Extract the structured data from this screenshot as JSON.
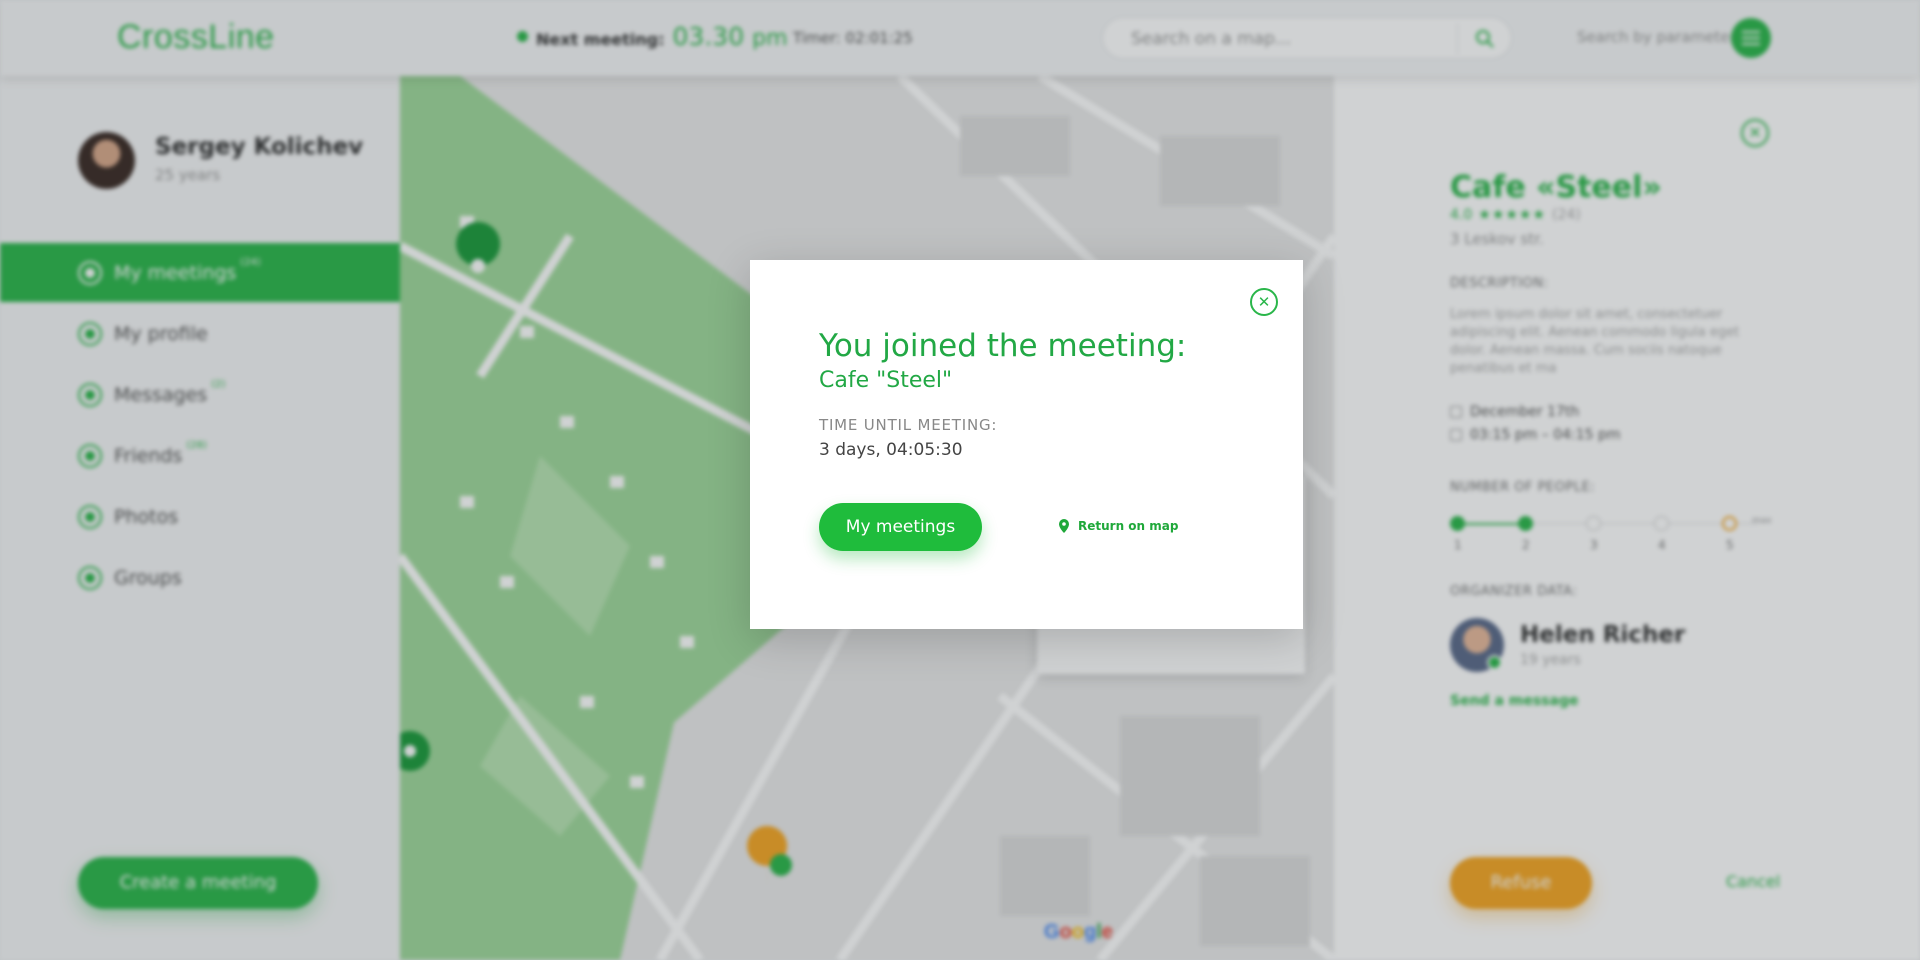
{
  "header": {
    "logo": "CrossLine",
    "next_meeting_label": "Next meeting:",
    "next_meeting_time": "03.30",
    "next_meeting_ampm": "pm",
    "timer": "Timer: 02:01:25",
    "search_placeholder": "Search on a map...",
    "search_params": "Search by parameters"
  },
  "user": {
    "name": "Sergey Kolichev",
    "age": "25 years"
  },
  "nav": [
    {
      "label": "My meetings",
      "count": "(24)",
      "active": true
    },
    {
      "label": "My profile",
      "count": ""
    },
    {
      "label": "Messages",
      "count": "(2)"
    },
    {
      "label": "Friends",
      "count": "(28)"
    },
    {
      "label": "Photos",
      "count": ""
    },
    {
      "label": "Groups",
      "count": ""
    }
  ],
  "create_button": "Create a meeting",
  "map": {
    "google": [
      "G",
      "o",
      "o",
      "g",
      "l",
      "e"
    ]
  },
  "details": {
    "title": "Cafe «Steel»",
    "rating": "4.0",
    "stars": "★★★★★",
    "reviews": "(24)",
    "address": "3 Leskov str.",
    "description_label": "Description:",
    "description": "Lorem ipsum dolor sit amet, consectetuer adipiscing elit. Aenean commodo ligula eget dolor. Aenean massa. Cum sociis natoque penatibus et ma",
    "date": "December 17th",
    "time": "03:15 pm – 04:15 pm",
    "people_label": "Number of people:",
    "people": [
      "1",
      "2",
      "3",
      "4",
      "5"
    ],
    "people_max": "max",
    "organizer_label": "Organizer data:",
    "organizer_name": "Helen Richer",
    "organizer_age": "19 years",
    "send_message": "Send a message",
    "refuse": "Refuse",
    "cancel": "Cancel"
  },
  "modal": {
    "title": "You joined the meeting:",
    "subtitle": "Cafe \"Steel\"",
    "time_label": "Time until meeting:",
    "time_value": "3 days, 04:05:30",
    "primary_button": "My meetings",
    "link": "Return on map"
  },
  "colors": {
    "accent": "#2ab64a",
    "warning": "#f5a623",
    "overlay": "#28303838"
  }
}
